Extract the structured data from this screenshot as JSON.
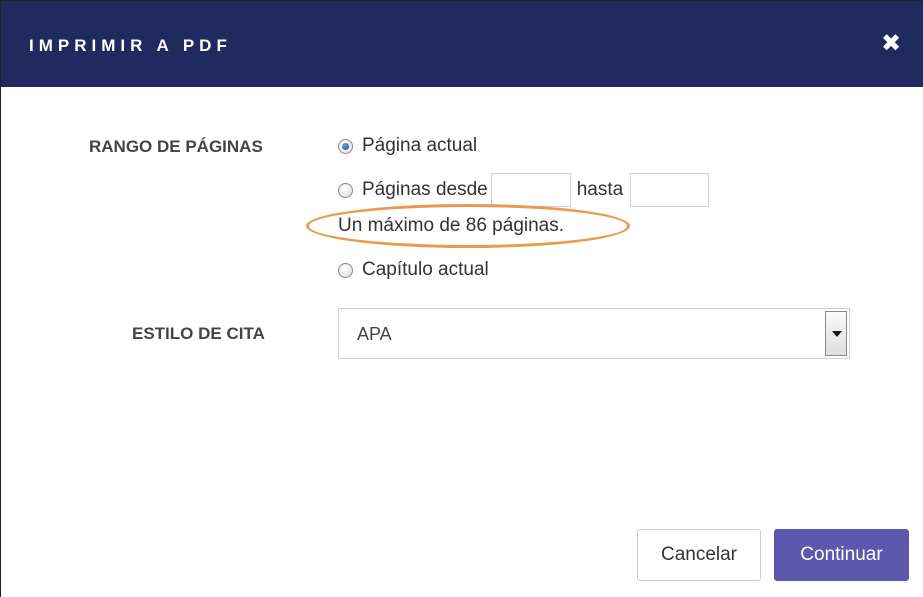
{
  "dialog": {
    "title": "IMPRIMIR A PDF",
    "close_symbol": "✖"
  },
  "page_range": {
    "label": "RANGO DE PÁGINAS",
    "options": [
      {
        "label": "Página actual",
        "checked": true
      },
      {
        "label": "Páginas desde",
        "checked": false
      },
      {
        "label": "Capítulo actual",
        "checked": false
      }
    ],
    "from_value": "",
    "to_label": "hasta",
    "to_value": "",
    "hint": "Un máximo de 86 páginas."
  },
  "citation": {
    "label": "ESTILO DE CITA",
    "selected": "APA"
  },
  "buttons": {
    "cancel": "Cancelar",
    "continue": "Continuar"
  },
  "colors": {
    "titlebar": "#1f2b5e",
    "primary_button": "#5b58ae",
    "annotation": "#e89a4e"
  }
}
